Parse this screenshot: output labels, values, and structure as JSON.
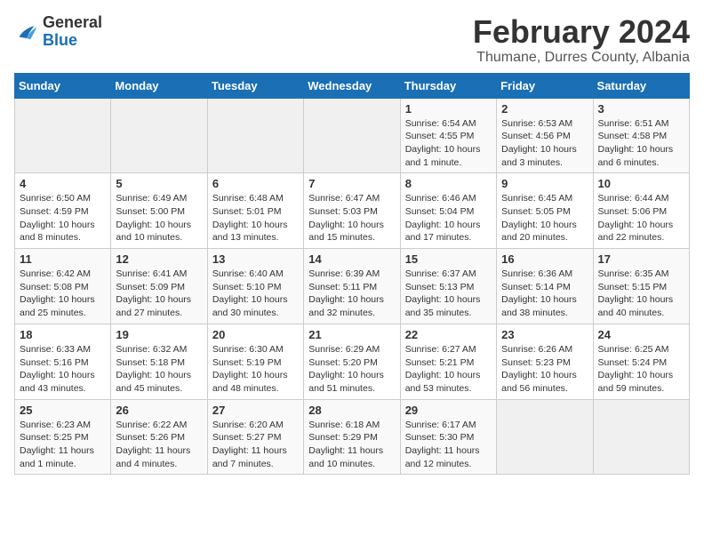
{
  "header": {
    "logo_general": "General",
    "logo_blue": "Blue",
    "month_year": "February 2024",
    "location": "Thumane, Durres County, Albania"
  },
  "days_of_week": [
    "Sunday",
    "Monday",
    "Tuesday",
    "Wednesday",
    "Thursday",
    "Friday",
    "Saturday"
  ],
  "weeks": [
    [
      {
        "day": "",
        "info": ""
      },
      {
        "day": "",
        "info": ""
      },
      {
        "day": "",
        "info": ""
      },
      {
        "day": "",
        "info": ""
      },
      {
        "day": "1",
        "info": "Sunrise: 6:54 AM\nSunset: 4:55 PM\nDaylight: 10 hours and 1 minute."
      },
      {
        "day": "2",
        "info": "Sunrise: 6:53 AM\nSunset: 4:56 PM\nDaylight: 10 hours and 3 minutes."
      },
      {
        "day": "3",
        "info": "Sunrise: 6:51 AM\nSunset: 4:58 PM\nDaylight: 10 hours and 6 minutes."
      }
    ],
    [
      {
        "day": "4",
        "info": "Sunrise: 6:50 AM\nSunset: 4:59 PM\nDaylight: 10 hours and 8 minutes."
      },
      {
        "day": "5",
        "info": "Sunrise: 6:49 AM\nSunset: 5:00 PM\nDaylight: 10 hours and 10 minutes."
      },
      {
        "day": "6",
        "info": "Sunrise: 6:48 AM\nSunset: 5:01 PM\nDaylight: 10 hours and 13 minutes."
      },
      {
        "day": "7",
        "info": "Sunrise: 6:47 AM\nSunset: 5:03 PM\nDaylight: 10 hours and 15 minutes."
      },
      {
        "day": "8",
        "info": "Sunrise: 6:46 AM\nSunset: 5:04 PM\nDaylight: 10 hours and 17 minutes."
      },
      {
        "day": "9",
        "info": "Sunrise: 6:45 AM\nSunset: 5:05 PM\nDaylight: 10 hours and 20 minutes."
      },
      {
        "day": "10",
        "info": "Sunrise: 6:44 AM\nSunset: 5:06 PM\nDaylight: 10 hours and 22 minutes."
      }
    ],
    [
      {
        "day": "11",
        "info": "Sunrise: 6:42 AM\nSunset: 5:08 PM\nDaylight: 10 hours and 25 minutes."
      },
      {
        "day": "12",
        "info": "Sunrise: 6:41 AM\nSunset: 5:09 PM\nDaylight: 10 hours and 27 minutes."
      },
      {
        "day": "13",
        "info": "Sunrise: 6:40 AM\nSunset: 5:10 PM\nDaylight: 10 hours and 30 minutes."
      },
      {
        "day": "14",
        "info": "Sunrise: 6:39 AM\nSunset: 5:11 PM\nDaylight: 10 hours and 32 minutes."
      },
      {
        "day": "15",
        "info": "Sunrise: 6:37 AM\nSunset: 5:13 PM\nDaylight: 10 hours and 35 minutes."
      },
      {
        "day": "16",
        "info": "Sunrise: 6:36 AM\nSunset: 5:14 PM\nDaylight: 10 hours and 38 minutes."
      },
      {
        "day": "17",
        "info": "Sunrise: 6:35 AM\nSunset: 5:15 PM\nDaylight: 10 hours and 40 minutes."
      }
    ],
    [
      {
        "day": "18",
        "info": "Sunrise: 6:33 AM\nSunset: 5:16 PM\nDaylight: 10 hours and 43 minutes."
      },
      {
        "day": "19",
        "info": "Sunrise: 6:32 AM\nSunset: 5:18 PM\nDaylight: 10 hours and 45 minutes."
      },
      {
        "day": "20",
        "info": "Sunrise: 6:30 AM\nSunset: 5:19 PM\nDaylight: 10 hours and 48 minutes."
      },
      {
        "day": "21",
        "info": "Sunrise: 6:29 AM\nSunset: 5:20 PM\nDaylight: 10 hours and 51 minutes."
      },
      {
        "day": "22",
        "info": "Sunrise: 6:27 AM\nSunset: 5:21 PM\nDaylight: 10 hours and 53 minutes."
      },
      {
        "day": "23",
        "info": "Sunrise: 6:26 AM\nSunset: 5:23 PM\nDaylight: 10 hours and 56 minutes."
      },
      {
        "day": "24",
        "info": "Sunrise: 6:25 AM\nSunset: 5:24 PM\nDaylight: 10 hours and 59 minutes."
      }
    ],
    [
      {
        "day": "25",
        "info": "Sunrise: 6:23 AM\nSunset: 5:25 PM\nDaylight: 11 hours and 1 minute."
      },
      {
        "day": "26",
        "info": "Sunrise: 6:22 AM\nSunset: 5:26 PM\nDaylight: 11 hours and 4 minutes."
      },
      {
        "day": "27",
        "info": "Sunrise: 6:20 AM\nSunset: 5:27 PM\nDaylight: 11 hours and 7 minutes."
      },
      {
        "day": "28",
        "info": "Sunrise: 6:18 AM\nSunset: 5:29 PM\nDaylight: 11 hours and 10 minutes."
      },
      {
        "day": "29",
        "info": "Sunrise: 6:17 AM\nSunset: 5:30 PM\nDaylight: 11 hours and 12 minutes."
      },
      {
        "day": "",
        "info": ""
      },
      {
        "day": "",
        "info": ""
      }
    ]
  ]
}
